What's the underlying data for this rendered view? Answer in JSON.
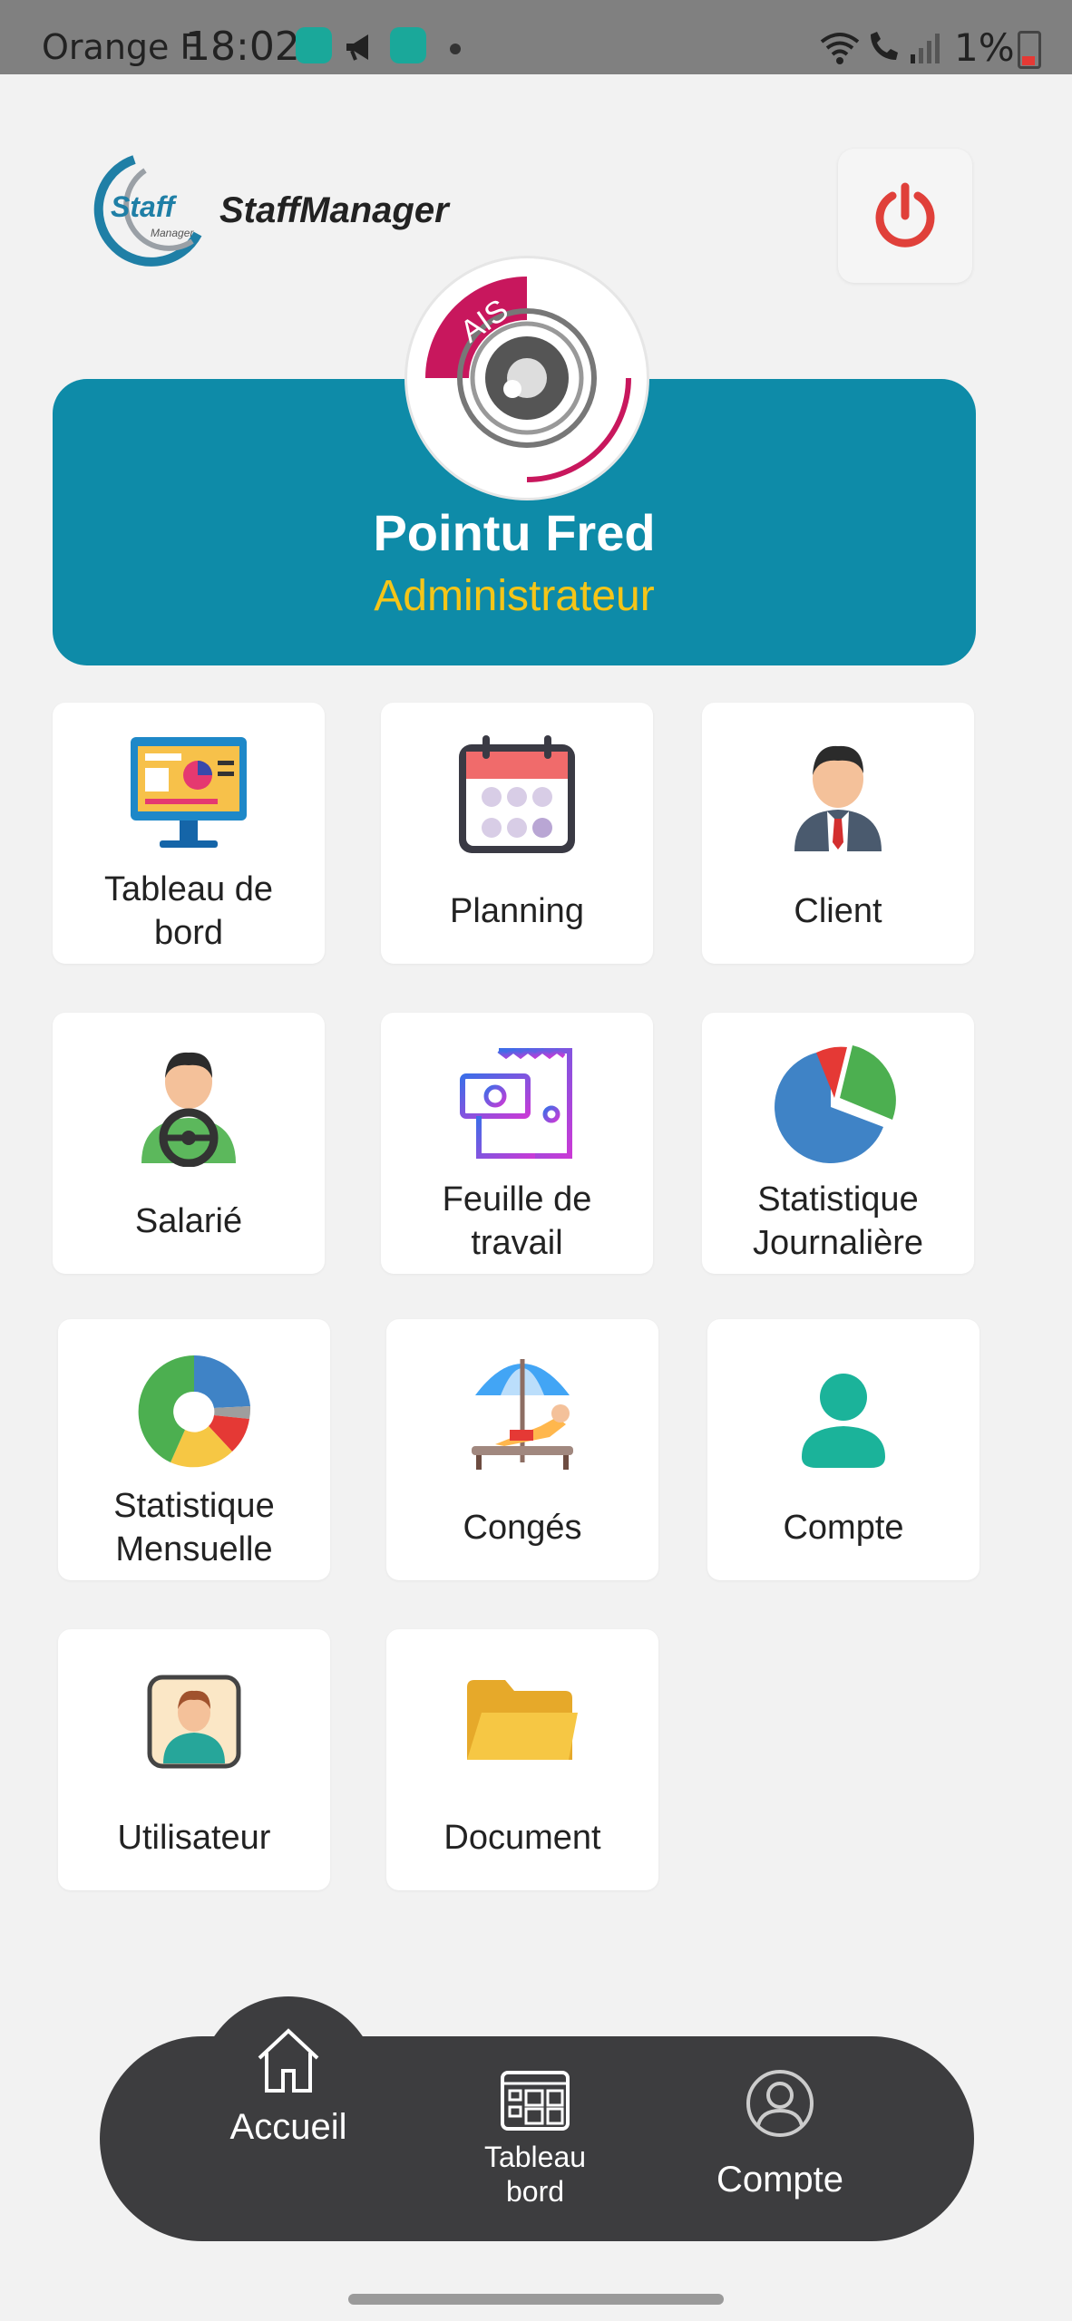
{
  "status_bar": {
    "carrier": "Orange F",
    "time": "18:02",
    "battery": "1%"
  },
  "header": {
    "logo_text": "Staff",
    "logo_subtext": "Manager",
    "app_name": "StaffManager",
    "power_icon": "power-icon"
  },
  "profile": {
    "avatar_text": "AIS",
    "name": "Pointu Fred",
    "role": "Administrateur"
  },
  "menu": [
    {
      "label_lines": [
        "Tableau de",
        "bord"
      ],
      "icon": "dashboard-monitor-icon"
    },
    {
      "label_lines": [
        "Planning"
      ],
      "icon": "calendar-icon"
    },
    {
      "label_lines": [
        "Client"
      ],
      "icon": "businessman-icon"
    },
    {
      "label_lines": [
        "Salarié"
      ],
      "icon": "driver-icon"
    },
    {
      "label_lines": [
        "Feuille de",
        "travail"
      ],
      "icon": "worksheet-icon"
    },
    {
      "label_lines": [
        "Statistique",
        "Journalière"
      ],
      "icon": "pie-chart-icon"
    },
    {
      "label_lines": [
        "Statistique",
        "Mensuelle"
      ],
      "icon": "donut-chart-icon"
    },
    {
      "label_lines": [
        "Congés"
      ],
      "icon": "beach-umbrella-icon"
    },
    {
      "label_lines": [
        "Compte"
      ],
      "icon": "user-icon"
    },
    {
      "label_lines": [
        "Utilisateur"
      ],
      "icon": "user-portrait-icon"
    },
    {
      "label_lines": [
        "Document"
      ],
      "icon": "folder-icon"
    }
  ],
  "bottom_nav": {
    "home": "Accueil",
    "dashboard_line1": "Tableau",
    "dashboard_line2": "bord",
    "account": "Compte"
  },
  "colors": {
    "profile_card": "#0e8ba8",
    "role_text": "#f5c518",
    "power": "#e0403a",
    "nav_bg": "#3d3d3f"
  }
}
